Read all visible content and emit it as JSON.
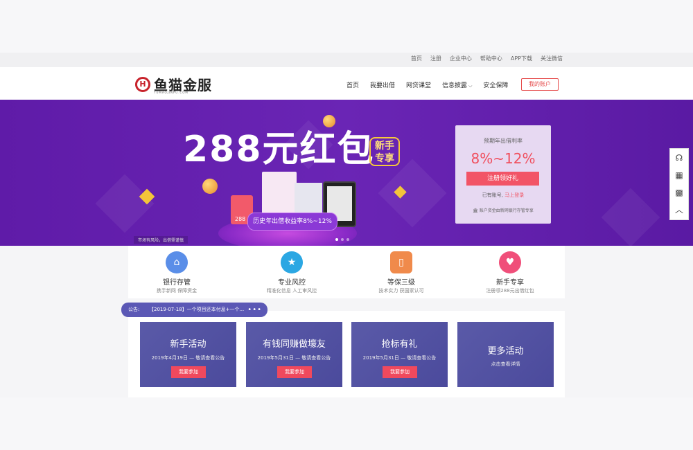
{
  "util_links": [
    "首页",
    "注册",
    "企业中心",
    "帮助中心",
    "APP下载",
    "关注微信"
  ],
  "logo": {
    "text": "鱼猫金服",
    "sub": "YUMAOJINFU.COM"
  },
  "nav": {
    "items": [
      "首页",
      "我要出借",
      "网贷课堂",
      "信息披露",
      "安全保障"
    ],
    "account": "我的账户"
  },
  "banner": {
    "title": "288元红包",
    "tag_line1": "新手",
    "tag_line2": "专享",
    "pill": "历史年出借收益率8%~12%",
    "redbox_label": "288",
    "notice": "市场有风险，出借需谨慎"
  },
  "rate_card": {
    "title": "预期年出借利率",
    "value": "8%~12%",
    "button": "注册领好礼",
    "login_text": "已有账号,",
    "login_link": "马上登录",
    "note": "账户资金由新网银行存管专享"
  },
  "features": [
    {
      "title": "银行存管",
      "sub": "携手新网 保障资金",
      "color": "#5a8ee8",
      "icon": "bank-icon"
    },
    {
      "title": "专业风控",
      "sub": "精准化信息 人工审风控",
      "color": "#2ba7e3",
      "icon": "shield-icon"
    },
    {
      "title": "等保三级",
      "sub": "技术实力 获国家认可",
      "color": "#f08a4b",
      "icon": "lock-icon"
    },
    {
      "title": "新手专享",
      "sub": "注册领288元出借红包",
      "color": "#f04f7a",
      "icon": "heart-icon"
    }
  ],
  "announcement": {
    "label": "公告:",
    "text": "【2019-07-18】一个项目还本付息+一个...",
    "more": "•••"
  },
  "promos": [
    {
      "title": "新手活动",
      "date": "2019年4月19日 — 敬请查看公告",
      "button": "我要参加"
    },
    {
      "title": "有钱同赚做壕友",
      "date": "2019年5月31日 — 敬请查看公告",
      "button": "我要参加"
    },
    {
      "title": "抢标有礼",
      "date": "2019年5月31日 — 敬请查看公告",
      "button": "我要参加"
    },
    {
      "title": "更多活动",
      "date": "点击查看详情",
      "button": ""
    }
  ],
  "sidebar_icons": [
    "headset-icon",
    "calculator-icon",
    "qrcode-icon",
    "back-to-top-icon"
  ]
}
